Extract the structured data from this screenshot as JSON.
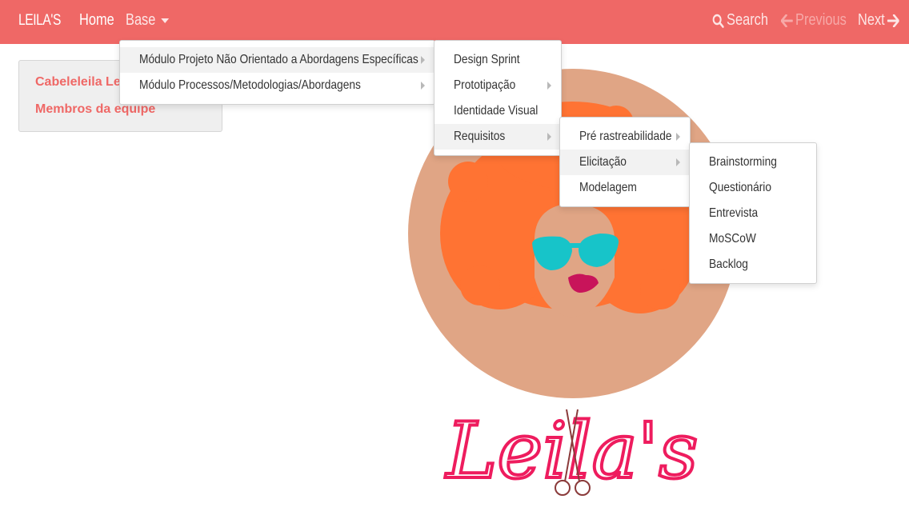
{
  "navbar": {
    "brand": "LEILA'S",
    "home": "Home",
    "base": "Base",
    "search": "Search",
    "previous": "Previous",
    "next": "Next"
  },
  "sidebar": {
    "items": [
      {
        "label": "Cabeleleila Leila"
      },
      {
        "label": "Membros da equipe"
      }
    ]
  },
  "menus": {
    "base": [
      {
        "label": "Módulo Projeto Não Orientado a Abordagens Específicas"
      },
      {
        "label": "Módulo Processos/Metodologias/Abordagens"
      }
    ],
    "projeto": [
      {
        "label": "Design Sprint"
      },
      {
        "label": "Prototipação"
      },
      {
        "label": "Identidade Visual"
      },
      {
        "label": "Requisitos"
      }
    ],
    "requisitos": [
      {
        "label": "Pré rastreabilidade"
      },
      {
        "label": "Elicitação"
      },
      {
        "label": "Modelagem"
      }
    ],
    "elicitacao": [
      {
        "label": "Brainstorming"
      },
      {
        "label": "Questionário"
      },
      {
        "label": "Entrevista"
      },
      {
        "label": "MoSCoW"
      },
      {
        "label": "Backlog"
      }
    ]
  },
  "logo": {
    "text": "Leila's"
  },
  "colors": {
    "navbar": "#ef6866",
    "accent": "#ef6866",
    "logo_circle": "#e0a585",
    "hair": "#ff7333",
    "glasses": "#17c4c9",
    "lips": "#c8145a",
    "logo_text": "#ee1c5e"
  },
  "icons": {
    "search": "search-icon",
    "previous": "arrow-left-icon",
    "next": "arrow-right-icon",
    "base_caret": "caret-down-icon"
  }
}
